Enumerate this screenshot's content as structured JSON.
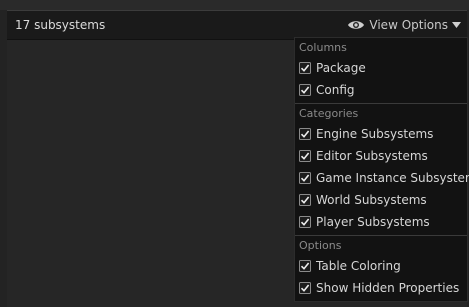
{
  "header": {
    "count_label": "17 subsystems",
    "view_options_label": "View Options",
    "view_options_icon": "eye-icon",
    "dropdown_icon": "caret-down-icon"
  },
  "menu": {
    "columns": {
      "title": "Columns",
      "items": [
        {
          "label": "Package",
          "checked": true
        },
        {
          "label": "Config",
          "checked": true
        }
      ]
    },
    "categories": {
      "title": "Categories",
      "items": [
        {
          "label": "Engine Subsystems",
          "checked": true
        },
        {
          "label": "Editor Subsystems",
          "checked": true
        },
        {
          "label": "Game Instance Subsystems",
          "checked": true
        },
        {
          "label": "World Subsystems",
          "checked": true
        },
        {
          "label": "Player Subsystems",
          "checked": true
        }
      ]
    },
    "options": {
      "title": "Options",
      "items": [
        {
          "label": "Table Coloring",
          "checked": true
        },
        {
          "label": "Show Hidden Properties",
          "checked": true
        }
      ]
    }
  },
  "colors": {
    "background": "#232323",
    "header": "#1a1a1a",
    "menu": "#121212",
    "text": "#d6d6d6",
    "section_title": "#8a8a8a"
  }
}
